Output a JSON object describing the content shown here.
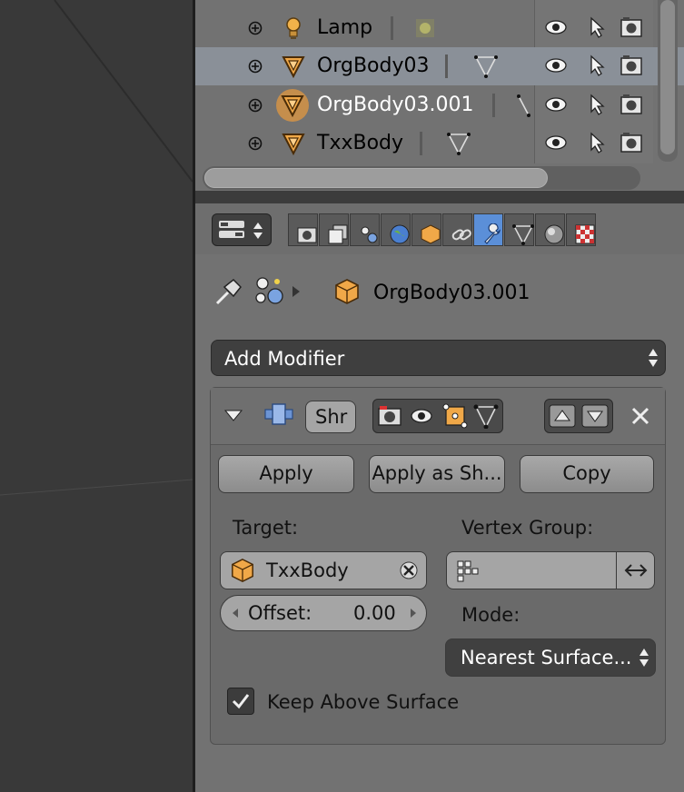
{
  "outliner": {
    "rows": [
      {
        "name": "Lamp",
        "type": "lamp"
      },
      {
        "name": "OrgBody03",
        "type": "mesh"
      },
      {
        "name": "OrgBody03.001",
        "type": "mesh",
        "active": true
      },
      {
        "name": "TxxBody",
        "type": "mesh"
      }
    ],
    "icons": {
      "visibility": "eye-icon",
      "select": "cursor-icon",
      "render": "camera-icon"
    }
  },
  "properties": {
    "tabs": [
      "render-icon",
      "render-layers-icon",
      "scene-icon",
      "world-icon",
      "object-icon",
      "constraints-icon",
      "modifiers-icon",
      "data-icon",
      "material-icon",
      "texture-icon"
    ],
    "active_tab": "modifiers-icon",
    "context": {
      "object_name": "OrgBody03.001"
    },
    "add_modifier_label": "Add Modifier",
    "modifier": {
      "name_short": "Shr",
      "apply_label": "Apply",
      "apply_shape_label": "Apply as Sh...",
      "copy_label": "Copy",
      "target_label": "Target:",
      "target_value": "TxxBody",
      "vertex_group_label": "Vertex Group:",
      "vertex_group_value": "",
      "offset_label": "Offset:",
      "offset_value": "0.00",
      "mode_label": "Mode:",
      "mode_value": "Nearest Surface...",
      "keep_above_label": "Keep Above Surface",
      "keep_above_checked": true
    }
  },
  "colors": {
    "accent": "#5b8fd8",
    "orange": "#e89a3c",
    "panel": "#727272"
  }
}
